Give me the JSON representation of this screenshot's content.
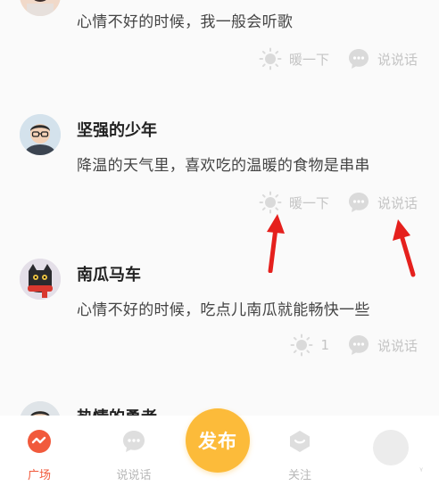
{
  "posts": [
    {
      "name": "",
      "content": "心情不好的时候，我一般会听歌",
      "warm_label": "暖一下",
      "comment_label": "说说话"
    },
    {
      "name": "坚强的少年",
      "content": "降温的天气里，喜欢吃的温暖的食物是串串",
      "warm_label": "暖一下",
      "comment_label": "说说话"
    },
    {
      "name": "南瓜马车",
      "content": "心情不好的时候，吃点儿南瓜就能畅快一些",
      "warm_label": "1",
      "comment_label": "说说话"
    },
    {
      "name": "热情的勇者",
      "content": "",
      "warm_label": "",
      "comment_label": ""
    }
  ],
  "tabbar": {
    "tabs": [
      {
        "label": "广场",
        "icon": "square-plaza-icon",
        "active": true
      },
      {
        "label": "说说话",
        "icon": "chat-bubble-icon",
        "active": false
      },
      {
        "label": "关注",
        "icon": "follow-icon",
        "active": false
      }
    ],
    "publish_label": "发布"
  },
  "colors": {
    "accent": "#f15a3c",
    "publish": "#fcbb3a",
    "annotation_arrow": "#e5201d",
    "muted": "#c4c4c4"
  }
}
